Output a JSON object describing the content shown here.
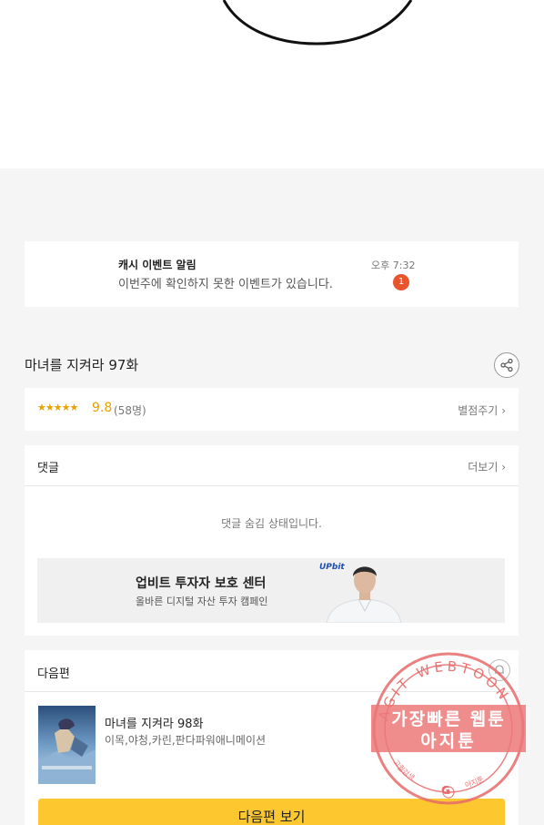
{
  "notification": {
    "title": "캐시 이벤트 알림",
    "message": "이번주에 확인하지 못한 이벤트가 있습니다.",
    "time": "오후 7:32",
    "badge_count": "1"
  },
  "episode": {
    "title": "마녀를 지켜라 97화",
    "share_icon": "share-icon"
  },
  "rating": {
    "stars": "★★★★★",
    "score": "9.8",
    "count": "(58명)",
    "rate_label": "별점주기",
    "chevron": "›"
  },
  "comments": {
    "label": "댓글",
    "more_label": "더보기",
    "chevron": "›",
    "hidden_message": "댓글 숨김 상태입니다."
  },
  "ad": {
    "title": "업비트 투자자 보호 센터",
    "subtitle": "올바른 디지털 자산 투자 캠페인",
    "brand": "UPbit"
  },
  "next_episode": {
    "label": "다음편",
    "bell_icon": "bell-icon",
    "name": "마녀를 지켜라 98화",
    "authors": "이목,야청,카린,판다파워애니메이션",
    "button_label": "다음편 보기"
  },
  "watermark": {
    "arc_top": "AGIT WEBTOON",
    "line1": "가장빠른 웹툰",
    "line2": "아지툰",
    "bottom_left": "고퀄검색",
    "bottom_right": "아지툰",
    "center_glyph": "G"
  },
  "colors": {
    "accent_yellow": "#fdc82f",
    "star_orange": "#e8a200",
    "badge_red": "#e8552c",
    "stamp_red": "#e66a6a"
  }
}
